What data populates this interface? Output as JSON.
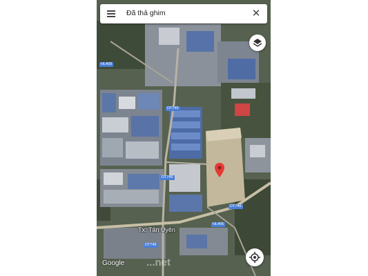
{
  "search": {
    "text": "Đã thả ghim"
  },
  "map": {
    "road_labels": [
      "HL409",
      "DT745",
      "DT745",
      "DT746",
      "HL406",
      "DT745"
    ],
    "town_label": "Tx. Tân Uyên",
    "attribution": "Google",
    "watermark": "...net"
  },
  "icons": {
    "menu": "hamburger-menu-icon",
    "close": "close-icon",
    "layers": "layers-icon",
    "locate": "my-location-icon",
    "pin": "dropped-pin-icon"
  },
  "colors": {
    "pin": "#e53935",
    "road_shield": "#4a7fd6",
    "land_cleared": "#c4b89c"
  }
}
